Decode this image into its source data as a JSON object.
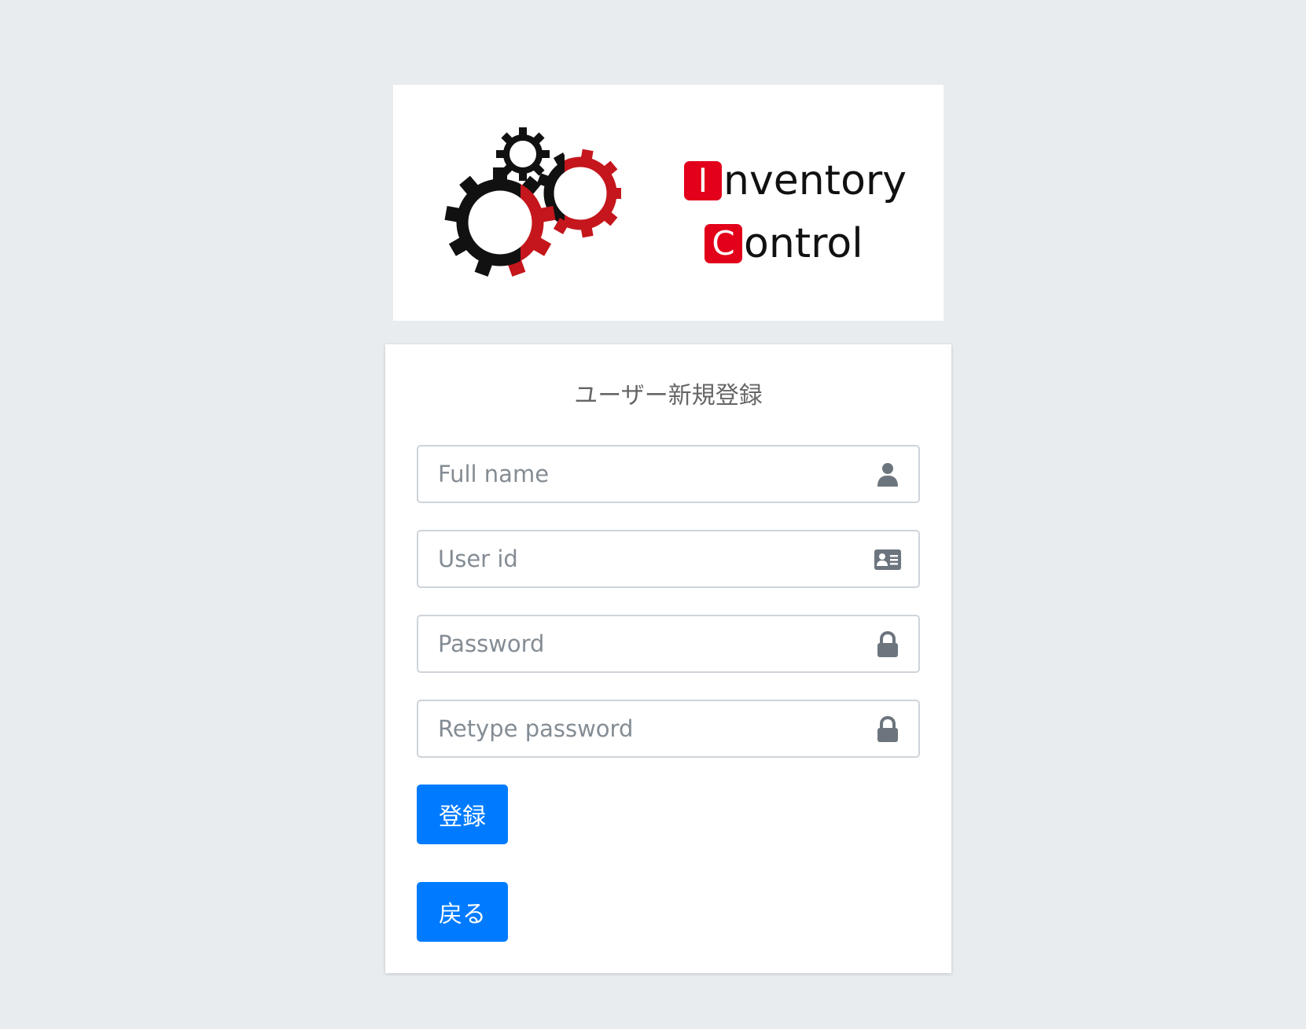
{
  "logo": {
    "line1_initial": "I",
    "line1_rest": "nventory",
    "line2_initial": "C",
    "line2_rest": "ontrol",
    "icon": "gears-logo",
    "accent_color": "#e2001a"
  },
  "form": {
    "title": "ユーザー新規登録",
    "fields": [
      {
        "placeholder": "Full name",
        "value": "",
        "icon": "user-icon"
      },
      {
        "placeholder": "User id",
        "value": "",
        "icon": "id-card-icon"
      },
      {
        "placeholder": "Password",
        "value": "",
        "icon": "lock-icon"
      },
      {
        "placeholder": "Retype password",
        "value": "",
        "icon": "lock-icon"
      }
    ],
    "register_label": "登録",
    "back_label": "戻る"
  },
  "colors": {
    "background": "#e9ecef",
    "button": "#007bff",
    "icon": "#6c757d"
  }
}
